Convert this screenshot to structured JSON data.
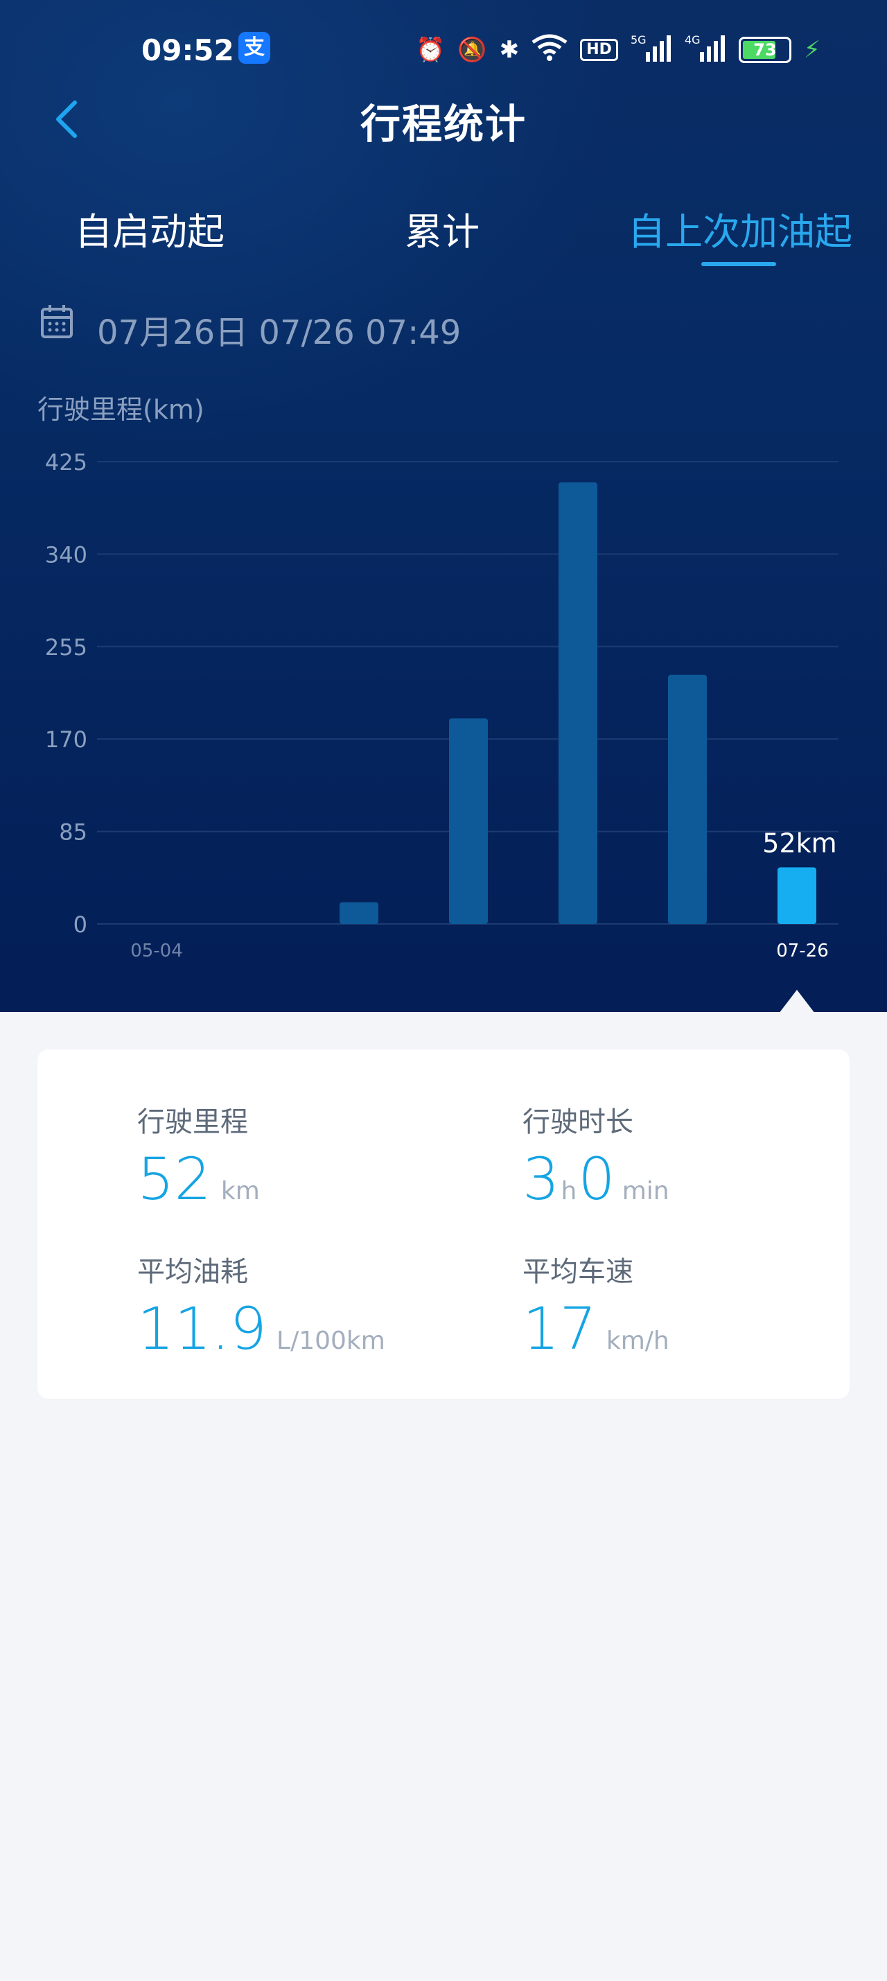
{
  "status_bar": {
    "time": "09:52",
    "app_badge": "支",
    "icons": [
      "alarm-icon",
      "mute-icon",
      "bluetooth-icon",
      "wifi-icon",
      "hd-icon",
      "signal-5g-icon",
      "signal-4g-icon"
    ],
    "hd_text": "HD",
    "signal_5g": "5G",
    "signal_4g": "4G",
    "battery_level": "73",
    "battery_fraction": 0.73
  },
  "header": {
    "title": "行程统计"
  },
  "tabs": [
    {
      "label": "自启动起",
      "active": false
    },
    {
      "label": "累计",
      "active": false
    },
    {
      "label": "自上次加油起",
      "active": true
    }
  ],
  "date_row": {
    "text": "07月26日 07/26 07:49"
  },
  "chart_data": {
    "type": "bar",
    "ylabel": "行驶里程(km)",
    "ylim": [
      0,
      425
    ],
    "yticks": [
      0,
      85,
      170,
      255,
      340,
      425
    ],
    "grid": true,
    "categories": [
      "05-04",
      "",
      "",
      "",
      "",
      "",
      "",
      "07-26"
    ],
    "x_tick_labels": [
      "05-04",
      "07-26"
    ],
    "values": [
      0,
      0,
      20,
      189,
      406,
      229,
      52
    ],
    "highlight_index": 6,
    "highlight_label": "52km",
    "colors": {
      "bar": "#0e5a99",
      "highlight": "#16aef0",
      "grid": "#1d3c72"
    }
  },
  "stats": {
    "distance": {
      "label": "行驶里程",
      "value": "52",
      "unit": "km"
    },
    "duration": {
      "label": "行驶时长",
      "hours": "3",
      "hours_unit": "h",
      "minutes": "0",
      "minutes_unit": "min"
    },
    "fuel": {
      "label": "平均油耗",
      "value": "11.9",
      "unit": "L/100km"
    },
    "speed": {
      "label": "平均车速",
      "value": "17",
      "unit": "km/h"
    }
  }
}
